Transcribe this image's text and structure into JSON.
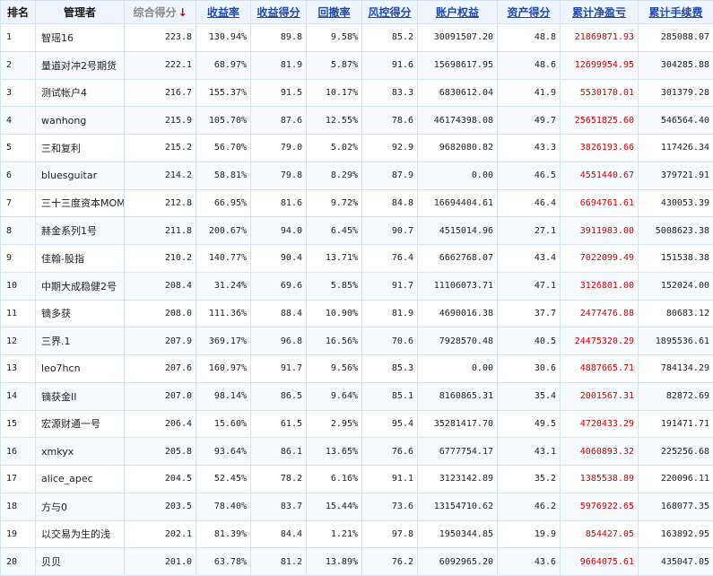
{
  "headers": {
    "rank": "排名",
    "manager": "管理者",
    "total_score": "综合得分",
    "sort_arrow": "↓",
    "return_rate": "收益率",
    "return_score": "收益得分",
    "drawdown": "回撤率",
    "risk_score": "风控得分",
    "equity": "账户权益",
    "asset_score": "资产得分",
    "net_profit": "累计净盈亏",
    "fees": "累计手续费"
  },
  "rows": [
    {
      "rank": "1",
      "name": "智瑶16",
      "score": "223.8",
      "ret": "130.94%",
      "ret_score": "89.8",
      "dd": "9.58%",
      "risk": "85.2",
      "equity": "30091507.20",
      "asset": "48.8",
      "profit": "21869871.93",
      "fee": "285088.07"
    },
    {
      "rank": "2",
      "name": "量道对冲2号期货",
      "score": "222.1",
      "ret": "68.97%",
      "ret_score": "81.9",
      "dd": "5.87%",
      "risk": "91.6",
      "equity": "15698617.95",
      "asset": "48.6",
      "profit": "12699954.95",
      "fee": "304285.88"
    },
    {
      "rank": "3",
      "name": "测试帐户4",
      "score": "216.7",
      "ret": "155.37%",
      "ret_score": "91.5",
      "dd": "10.17%",
      "risk": "83.3",
      "equity": "6830612.04",
      "asset": "41.9",
      "profit": "5530170.01",
      "fee": "301379.28"
    },
    {
      "rank": "4",
      "name": "wanhong",
      "score": "215.9",
      "ret": "105.70%",
      "ret_score": "87.6",
      "dd": "12.55%",
      "risk": "78.6",
      "equity": "46174398.08",
      "asset": "49.7",
      "profit": "25651825.60",
      "fee": "546564.40"
    },
    {
      "rank": "5",
      "name": "三和复利",
      "score": "215.2",
      "ret": "56.70%",
      "ret_score": "79.0",
      "dd": "5.02%",
      "risk": "92.9",
      "equity": "9682080.82",
      "asset": "43.3",
      "profit": "3826193.66",
      "fee": "117426.34"
    },
    {
      "rank": "6",
      "name": "bluesguitar",
      "score": "214.2",
      "ret": "58.81%",
      "ret_score": "79.8",
      "dd": "8.29%",
      "risk": "87.9",
      "equity": "0.00",
      "asset": "46.5",
      "profit": "4551440.67",
      "fee": "379721.91"
    },
    {
      "rank": "7",
      "name": "三十三度资本MOM",
      "score": "212.8",
      "ret": "66.95%",
      "ret_score": "81.6",
      "dd": "9.72%",
      "risk": "84.8",
      "equity": "16694404.61",
      "asset": "46.4",
      "profit": "6694761.61",
      "fee": "430053.39"
    },
    {
      "rank": "8",
      "name": "赫金系列1号",
      "score": "211.8",
      "ret": "200.67%",
      "ret_score": "94.0",
      "dd": "6.45%",
      "risk": "90.7",
      "equity": "4515014.96",
      "asset": "27.1",
      "profit": "3911983.00",
      "fee": "5008623.38"
    },
    {
      "rank": "9",
      "name": "佳翰-股指",
      "score": "210.2",
      "ret": "140.77%",
      "ret_score": "90.4",
      "dd": "13.71%",
      "risk": "76.4",
      "equity": "6662768.07",
      "asset": "43.4",
      "profit": "7022099.49",
      "fee": "151538.38"
    },
    {
      "rank": "10",
      "name": "中期大成稳健2号",
      "score": "208.4",
      "ret": "31.24%",
      "ret_score": "69.6",
      "dd": "5.85%",
      "risk": "91.7",
      "equity": "11106073.71",
      "asset": "47.1",
      "profit": "3126801.00",
      "fee": "152024.00"
    },
    {
      "rank": "11",
      "name": "镝多获",
      "score": "208.0",
      "ret": "111.36%",
      "ret_score": "88.4",
      "dd": "10.90%",
      "risk": "81.9",
      "equity": "4690016.38",
      "asset": "37.7",
      "profit": "2477476.88",
      "fee": "80683.12"
    },
    {
      "rank": "12",
      "name": "三界.1",
      "score": "207.9",
      "ret": "369.17%",
      "ret_score": "96.8",
      "dd": "16.56%",
      "risk": "70.6",
      "equity": "7928570.48",
      "asset": "40.5",
      "profit": "24475320.29",
      "fee": "1895536.61"
    },
    {
      "rank": "13",
      "name": "leo7hcn",
      "score": "207.6",
      "ret": "160.97%",
      "ret_score": "91.7",
      "dd": "9.56%",
      "risk": "85.3",
      "equity": "0.00",
      "asset": "30.6",
      "profit": "4887665.71",
      "fee": "784134.29"
    },
    {
      "rank": "14",
      "name": "镝获金II",
      "score": "207.0",
      "ret": "98.14%",
      "ret_score": "86.5",
      "dd": "9.64%",
      "risk": "85.1",
      "equity": "8160865.31",
      "asset": "35.4",
      "profit": "2001567.31",
      "fee": "82872.69"
    },
    {
      "rank": "15",
      "name": "宏源财通一号",
      "score": "206.4",
      "ret": "15.60%",
      "ret_score": "61.5",
      "dd": "2.95%",
      "risk": "95.4",
      "equity": "35281417.70",
      "asset": "49.5",
      "profit": "4720433.29",
      "fee": "191471.71"
    },
    {
      "rank": "16",
      "name": "xmkyx",
      "score": "205.8",
      "ret": "93.64%",
      "ret_score": "86.1",
      "dd": "13.65%",
      "risk": "76.6",
      "equity": "6777754.17",
      "asset": "43.1",
      "profit": "4060893.32",
      "fee": "225256.68"
    },
    {
      "rank": "17",
      "name": "alice_apec",
      "score": "204.5",
      "ret": "52.45%",
      "ret_score": "78.2",
      "dd": "6.16%",
      "risk": "91.1",
      "equity": "3123142.89",
      "asset": "35.2",
      "profit": "1385538.89",
      "fee": "220096.11"
    },
    {
      "rank": "18",
      "name": "方与0",
      "score": "203.5",
      "ret": "78.40%",
      "ret_score": "83.7",
      "dd": "15.44%",
      "risk": "73.6",
      "equity": "13154710.62",
      "asset": "46.2",
      "profit": "5976922.65",
      "fee": "168077.35"
    },
    {
      "rank": "19",
      "name": "以交易为生的浅",
      "score": "202.1",
      "ret": "81.39%",
      "ret_score": "84.4",
      "dd": "1.21%",
      "risk": "97.8",
      "equity": "1950344.85",
      "asset": "19.9",
      "profit": "854427.05",
      "fee": "163892.95"
    },
    {
      "rank": "20",
      "name": "贝贝",
      "score": "201.0",
      "ret": "63.78%",
      "ret_score": "81.2",
      "dd": "13.89%",
      "risk": "76.2",
      "equity": "6092965.20",
      "asset": "43.6",
      "profit": "9664075.61",
      "fee": "435047.05"
    }
  ]
}
